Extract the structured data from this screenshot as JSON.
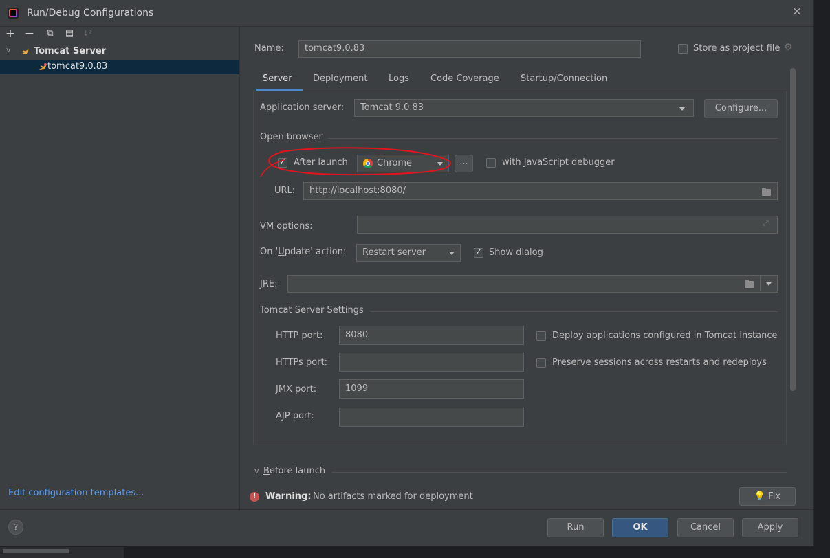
{
  "window": {
    "title": "Run/Debug Configurations",
    "close": "×"
  },
  "left": {
    "toolbar": [
      "+",
      "−",
      "⧉",
      "▤",
      "↓²"
    ],
    "tree": {
      "parent": {
        "label": "Tomcat Server",
        "chevron": "v"
      },
      "child": {
        "label": "tomcat9.0.83"
      }
    },
    "edit_templates": "Edit configuration templates..."
  },
  "form": {
    "name_label": "Name:",
    "name_value": "tomcat9.0.83",
    "store_label": "Store as project file",
    "tabs": [
      "Server",
      "Deployment",
      "Logs",
      "Code Coverage",
      "Startup/Connection"
    ],
    "active_tab": "Server",
    "app_server_label": "Application server:",
    "app_server_value": "Tomcat 9.0.83",
    "configure_button": "Configure...",
    "open_browser_title": "Open browser",
    "after_launch_label": "After launch",
    "browser_value": "Chrome",
    "browse_button": "...",
    "js_debugger_label": "with JavaScript debugger",
    "url_label": "URL:",
    "url_value": "http://localhost:8080/",
    "vm_options_label": "VM options:",
    "vm_options_value": "",
    "update_action_label": "On 'Update' action:",
    "update_action_value": "Restart server",
    "show_dialog_label": "Show dialog",
    "jre_label": "JRE:",
    "jre_value": "",
    "tomcat_settings_title": "Tomcat Server Settings",
    "http_port_label": "HTTP port:",
    "http_port_value": "8080",
    "https_port_label": "HTTPs port:",
    "https_port_value": "",
    "jmx_port_label": "JMX port:",
    "jmx_port_value": "1099",
    "ajp_port_label": "AJP port:",
    "ajp_port_value": "",
    "deploy_label": "Deploy applications configured in Tomcat instance",
    "preserve_label": "Preserve sessions across restarts and redeploys",
    "before_launch": "Before launch",
    "warning_bold": "Warning:",
    "warning_text": "No artifacts marked for deployment",
    "fix_button": "Fix"
  },
  "buttons": {
    "run": "Run",
    "ok": "OK",
    "cancel": "Cancel",
    "apply": "Apply"
  },
  "help": "?",
  "colors": {
    "accent": "#365880",
    "link": "#589df6",
    "warning": "#c75450",
    "annotation": "#e0141e"
  }
}
